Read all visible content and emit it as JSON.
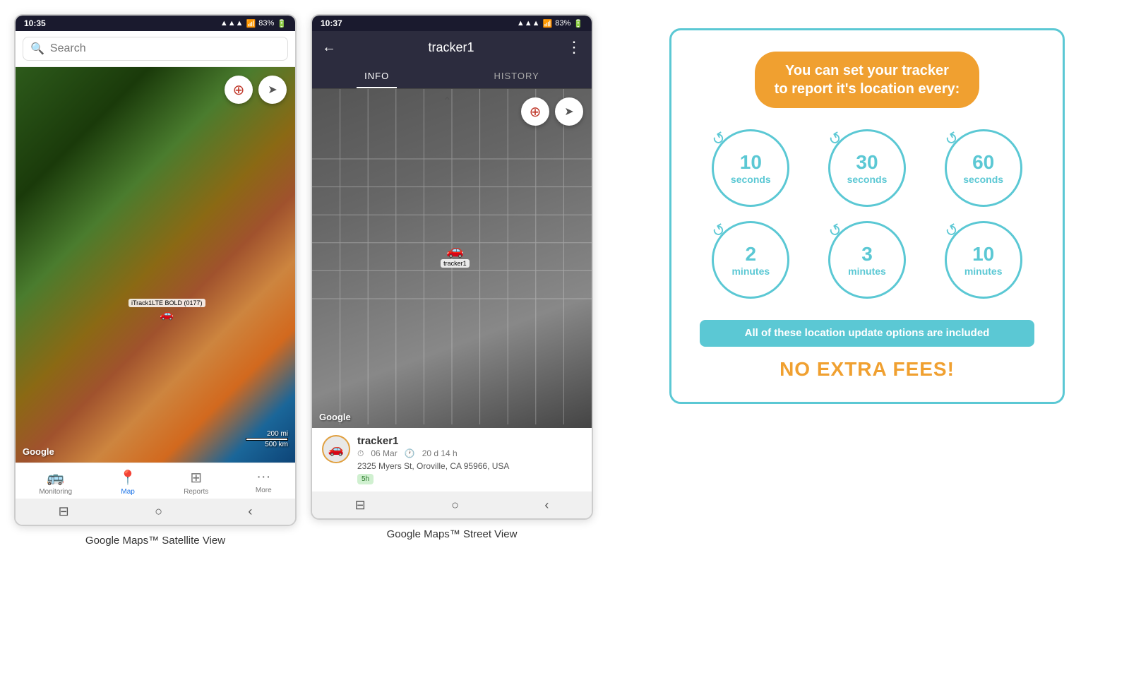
{
  "phone1": {
    "status_bar": {
      "time": "10:35",
      "signal": "📶",
      "battery": "83%"
    },
    "search_placeholder": "Search",
    "map_type": "satellite",
    "tracker_label": "iTrack1LTE BOLD (0177)",
    "google_label": "Google",
    "scale_top": "200 mi",
    "scale_bottom": "500 km",
    "compass_icon": "⊕",
    "nav_icon": "➤",
    "bottom_nav": [
      {
        "label": "Monitoring",
        "icon": "🚌",
        "active": false
      },
      {
        "label": "Map",
        "icon": "📍",
        "active": true
      },
      {
        "label": "Reports",
        "icon": "⊞",
        "active": false
      },
      {
        "label": "More",
        "icon": "···",
        "active": false
      }
    ],
    "caption": "Google Maps™ Satellite View"
  },
  "phone2": {
    "status_bar": {
      "time": "10:37",
      "signal": "📶",
      "battery": "83%"
    },
    "header_title": "tracker1",
    "tabs": [
      {
        "label": "INFO",
        "active": true
      },
      {
        "label": "HISTORY",
        "active": false
      }
    ],
    "map_type": "street",
    "tracker_label": "tracker1",
    "google_label": "Google",
    "tracker_info": {
      "name": "tracker1",
      "icon": "🚗",
      "p_icon": "P",
      "date": "06 Mar",
      "duration": "20 d 14 h",
      "address": "2325 Myers St, Oroville, CA 95966, USA",
      "badge": "5h"
    },
    "caption": "Google Maps™ Street View"
  },
  "promo": {
    "title_line1": "You can set your tracker",
    "title_line2": "to report it's location every:",
    "intervals": [
      {
        "number": "10",
        "unit": "seconds"
      },
      {
        "number": "30",
        "unit": "seconds"
      },
      {
        "number": "60",
        "unit": "seconds"
      },
      {
        "number": "2",
        "unit": "minutes"
      },
      {
        "number": "3",
        "unit": "minutes"
      },
      {
        "number": "10",
        "unit": "minutes"
      }
    ],
    "included_text": "All of these location update options are included",
    "no_fees_text": "NO EXTRA FEES!"
  }
}
